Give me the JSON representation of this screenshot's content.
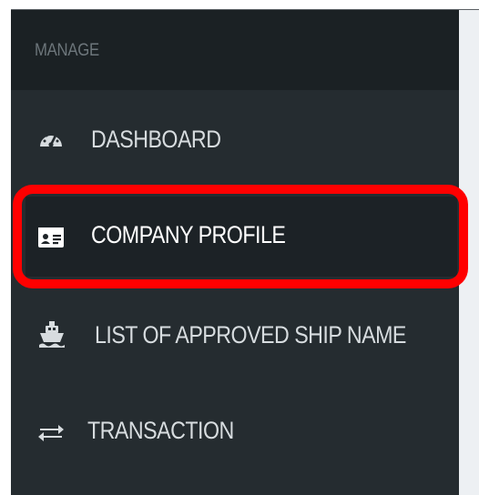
{
  "sidebar": {
    "section_label": "MANAGE",
    "items": [
      {
        "label": "DASHBOARD",
        "icon": "dashboard-gauge-icon",
        "active": false
      },
      {
        "label": "COMPANY PROFILE",
        "icon": "id-card-icon",
        "active": true
      },
      {
        "label": "LIST OF APPROVED SHIP NAME",
        "icon": "ship-icon",
        "active": false
      },
      {
        "label": "TRANSACTION",
        "icon": "exchange-arrows-icon",
        "active": false
      }
    ]
  },
  "colors": {
    "sidebar_bg": "#252c30",
    "header_bg": "#1b2124",
    "active_bg": "#1c2226",
    "highlight": "#ff0000",
    "text": "#d7dcdf",
    "muted_text": "#6d767b"
  }
}
